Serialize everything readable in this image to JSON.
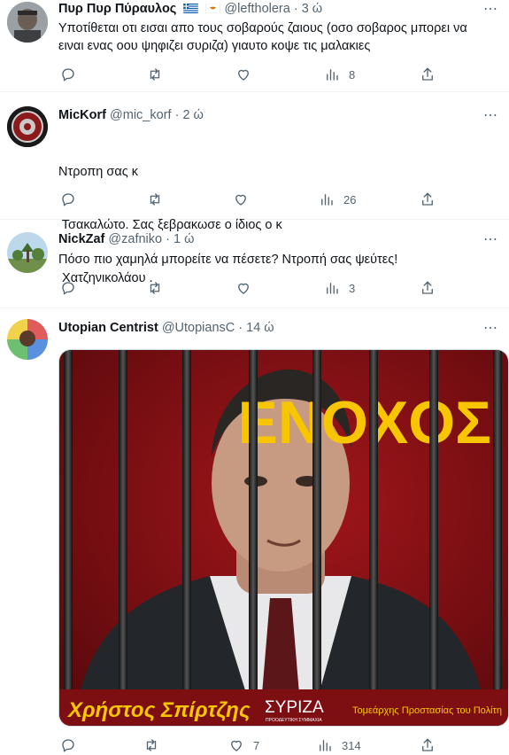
{
  "tweets": [
    {
      "name": "Πυρ Πυρ Πύραυλος",
      "handle": "@leftholera",
      "time": "3 ώ",
      "lines": [
        "Υποτίθεται οτι εισαι απο τους σοβαρούς ζαιους (οσο σοβαρος μπορει να",
        "ειναι ενας οου ψηφιζει συριζα) γιαυτο κοψε τις μαλακιες"
      ],
      "views": "8"
    },
    {
      "name": "MicKorf",
      "handle": "@mic_korf",
      "time": "2 ώ",
      "lines": [
        "Ντροπη σας κ",
        " Τσακαλώτο. Σας ξεβρακωσε ο ίδιος ο κ",
        " Χατζηνικολάου ."
      ],
      "views": "26"
    },
    {
      "name": "NickZaf",
      "handle": "@zafniko",
      "time": "1 ώ",
      "lines": [
        "Πόσο πιο χαμηλά μπορείτε να πέσετε? Ντροπή σας ψεύτες!"
      ],
      "views": "3"
    },
    {
      "name": "Utopian Centrist",
      "handle": "@UtopiansC",
      "time": "14 ώ",
      "lines": [],
      "likes": "7",
      "views": "314"
    }
  ],
  "separator": "·",
  "more_icon": "⋯",
  "poster": {
    "headline": "ΕΝΟΧΟΣ",
    "person_name": "Χρήστος Σπίρτζης",
    "party_logo": "ΣΥΡΙΖΑ",
    "party_sub": "ΠΡΟΟΔΕΥΤΙΚΗ ΣΥΜΜΑΧΙΑ",
    "role": "Τομεάρχης Προστασίας του Πολίτη"
  },
  "colors": {
    "poster_bg": "#7d0e12",
    "headline": "#f7c600",
    "muted": "#536471",
    "bars": "#2c2c2c"
  },
  "icons": [
    "reply-icon",
    "retweet-icon",
    "like-icon",
    "views-icon",
    "share-icon",
    "more-icon"
  ]
}
